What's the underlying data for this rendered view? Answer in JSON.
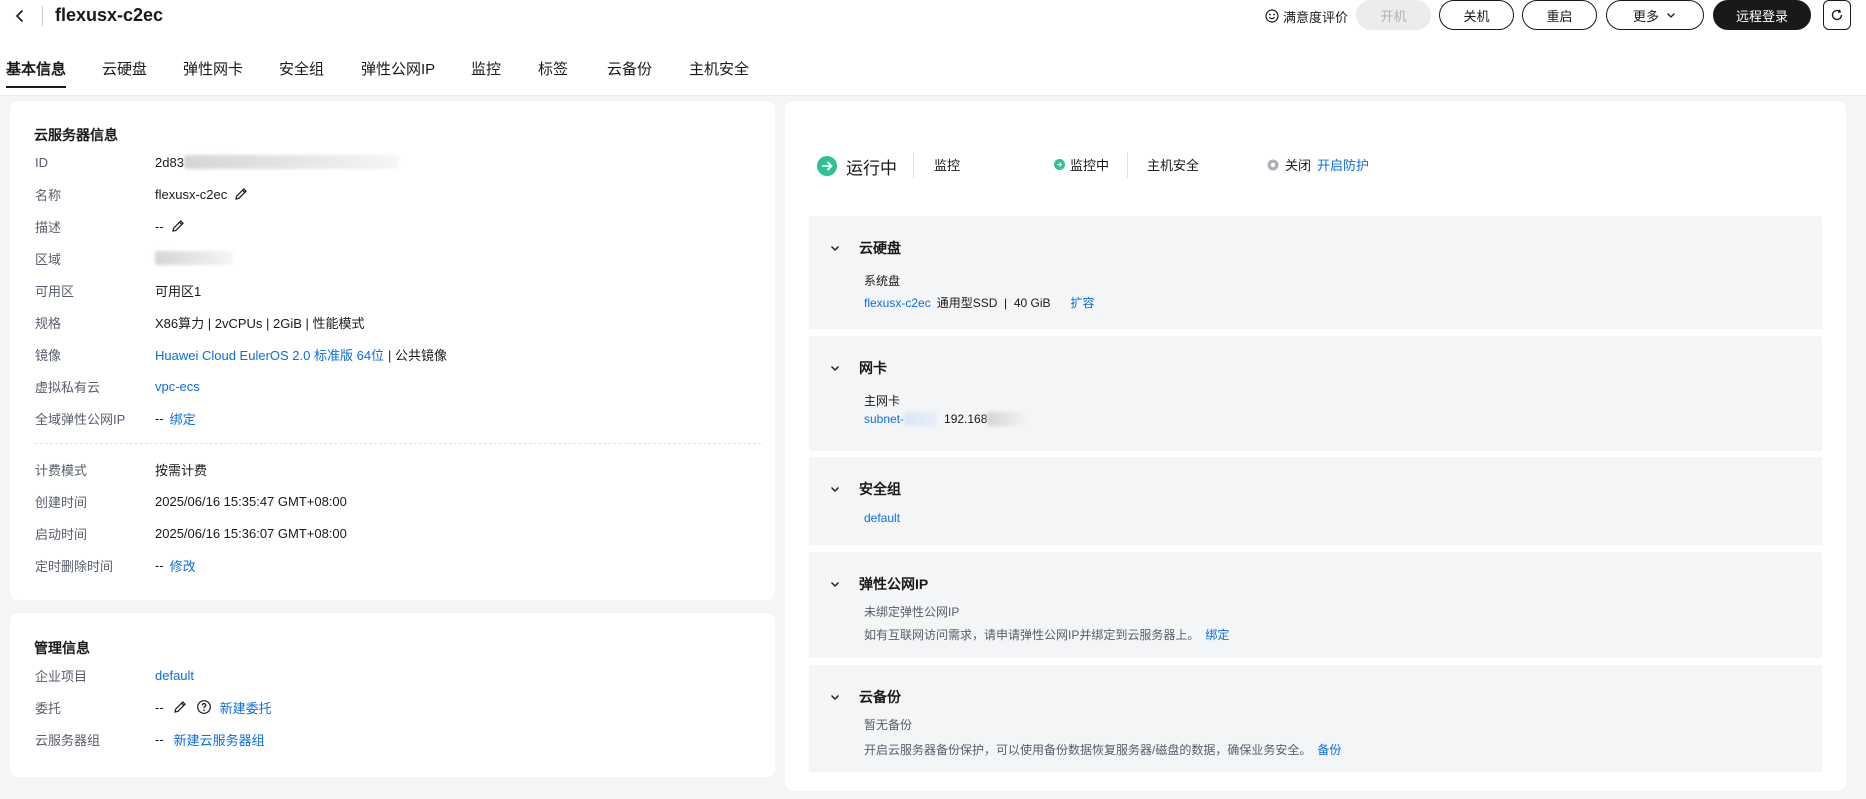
{
  "header": {
    "title": "flexusx-c2ec",
    "survey_label": "满意度评价",
    "buttons": {
      "start": "开机",
      "stop": "关机",
      "restart": "重启",
      "more": "更多",
      "remote_login": "远程登录"
    }
  },
  "tabs": [
    "基本信息",
    "云硬盘",
    "弹性网卡",
    "安全组",
    "弹性公网IP",
    "监控",
    "标签",
    "云备份",
    "主机安全"
  ],
  "server_info": {
    "title": "云服务器信息",
    "id_label": "ID",
    "id_value": "2d83",
    "name_label": "名称",
    "name_value": "flexusx-c2ec",
    "desc_label": "描述",
    "desc_value": "--",
    "region_label": "区域",
    "az_label": "可用区",
    "az_value": "可用区1",
    "spec_label": "规格",
    "spec_value": "X86算力 | 2vCPUs | 2GiB | 性能模式",
    "image_label": "镜像",
    "image_link": "Huawei Cloud EulerOS 2.0 标准版 64位",
    "image_suffix": "| 公共镜像",
    "vpc_label": "虚拟私有云",
    "vpc_value": "vpc-ecs",
    "gip_label": "全域弹性公网IP",
    "gip_value": "--",
    "gip_action": "绑定",
    "billing_label": "计费模式",
    "billing_value": "按需计费",
    "created_label": "创建时间",
    "created_value": "2025/06/16 15:35:47 GMT+08:00",
    "started_label": "启动时间",
    "started_value": "2025/06/16 15:36:07 GMT+08:00",
    "delete_label": "定时删除时间",
    "delete_value": "--",
    "delete_action": "修改"
  },
  "mgmt_info": {
    "title": "管理信息",
    "project_label": "企业项目",
    "project_value": "default",
    "agency_label": "委托",
    "agency_value": "--",
    "agency_action": "新建委托",
    "group_label": "云服务器组",
    "group_value": "--",
    "group_action": "新建云服务器组"
  },
  "status": {
    "running": "运行中",
    "monitor_label": "监控",
    "monitor_value": "监控中",
    "hss_label": "主机安全",
    "hss_value": "关闭",
    "hss_action": "开启防护"
  },
  "sections": {
    "disk": {
      "title": "云硬盘",
      "sub": "系统盘",
      "link": "flexusx-c2ec",
      "detail": "通用型SSD  |  40 GiB",
      "action": "扩容"
    },
    "nic": {
      "title": "网卡",
      "sub": "主网卡",
      "link": "subnet-",
      "ip": "192.168"
    },
    "sg": {
      "title": "安全组",
      "link": "default"
    },
    "eip": {
      "title": "弹性公网IP",
      "sub": "未绑定弹性公网IP",
      "desc": "如有互联网访问需求，请申请弹性公网IP并绑定到云服务器上。",
      "action": "绑定"
    },
    "backup": {
      "title": "云备份",
      "sub": "暂无备份",
      "desc": "开启云服务器备份保护，可以使用备份数据恢复服务器/磁盘的数据，确保业务安全。",
      "action": "备份"
    }
  },
  "colors": {
    "link": "#0a6ee6",
    "running": "#2ec193",
    "background": "#f4f5f7"
  }
}
